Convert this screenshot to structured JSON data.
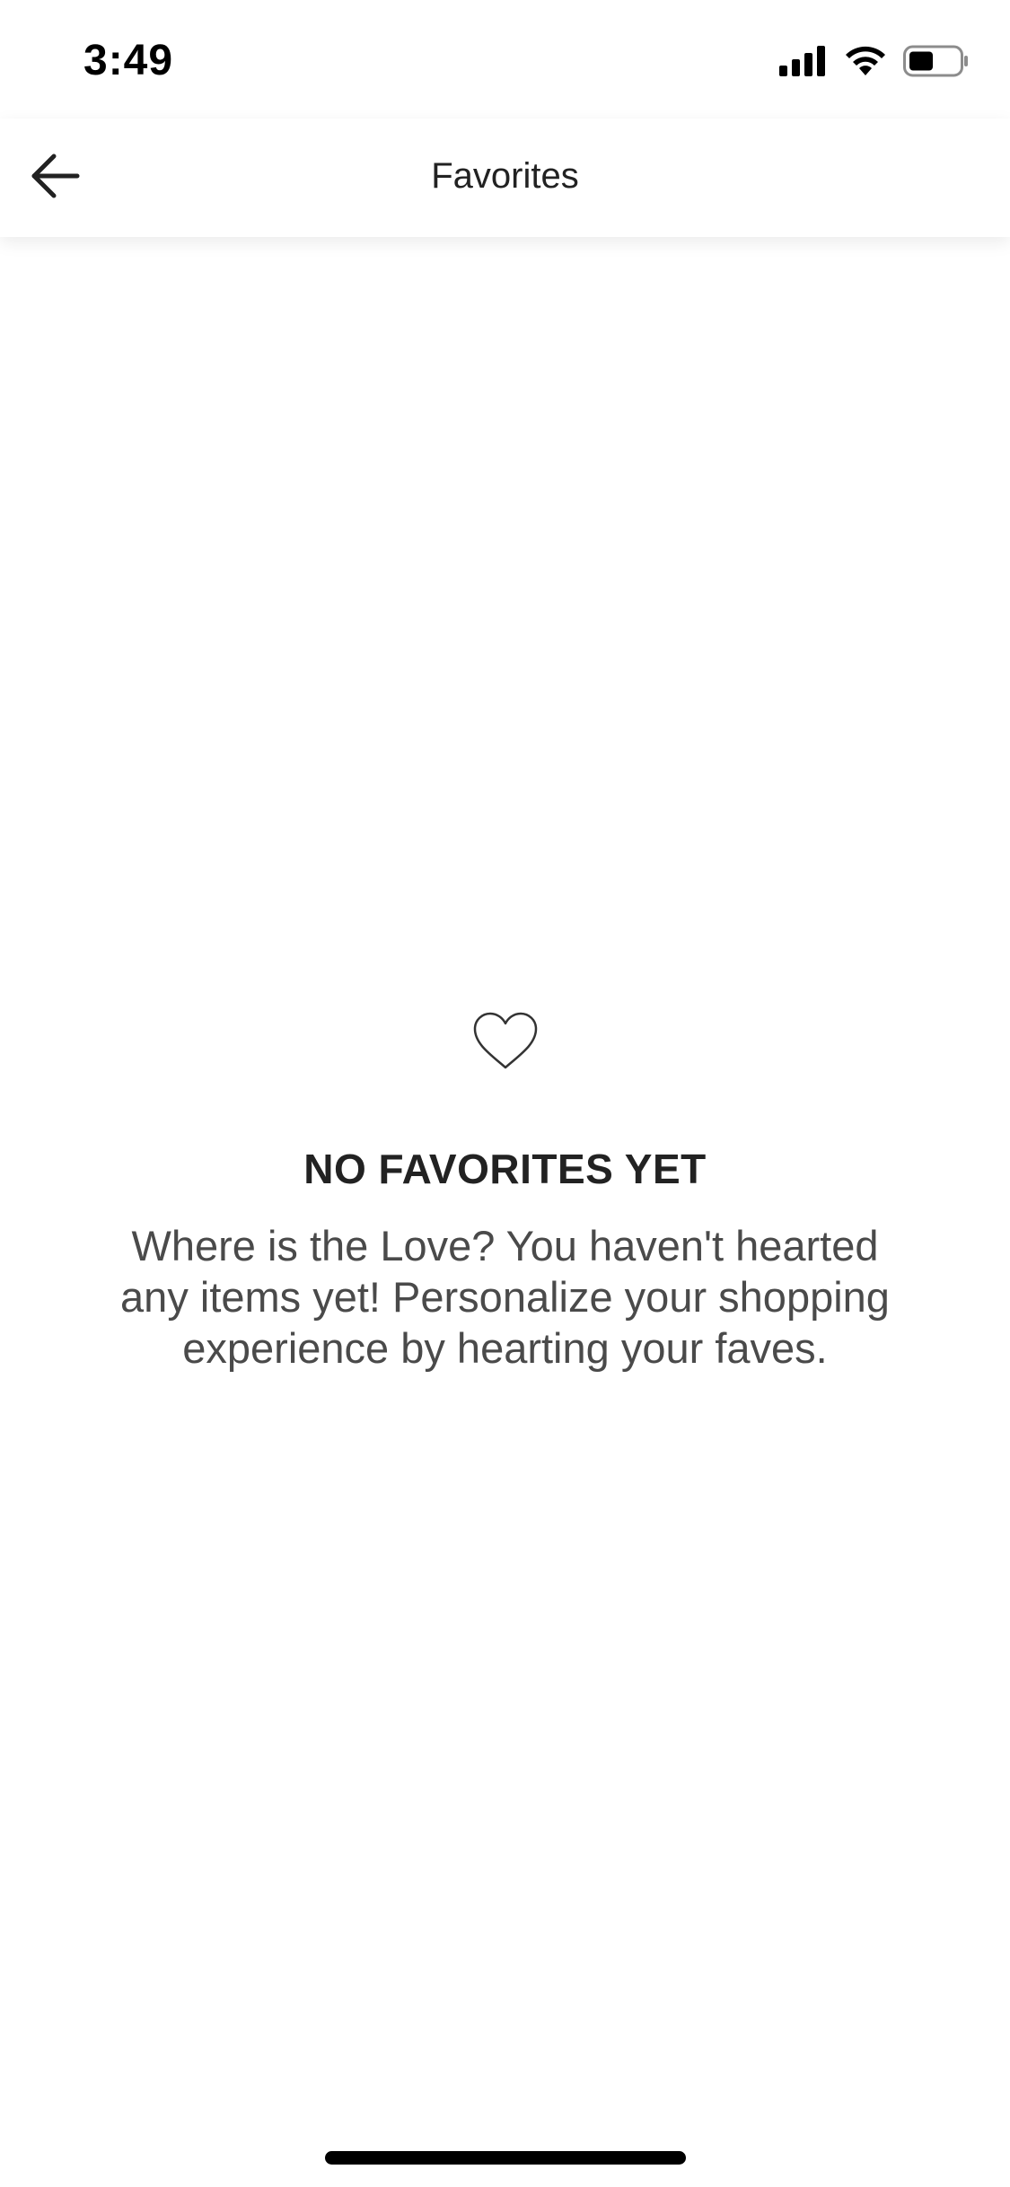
{
  "status_bar": {
    "time": "3:49"
  },
  "header": {
    "title": "Favorites"
  },
  "empty_state": {
    "icon": "heart-outline-icon",
    "title": "NO FAVORITES YET",
    "message": "Where is the Love? You haven't hearted any items yet! Personalize your shopping experience by hearting your faves."
  },
  "colors": {
    "background": "#ffffff",
    "text_primary": "#222222",
    "text_secondary": "#4a4a4a"
  }
}
